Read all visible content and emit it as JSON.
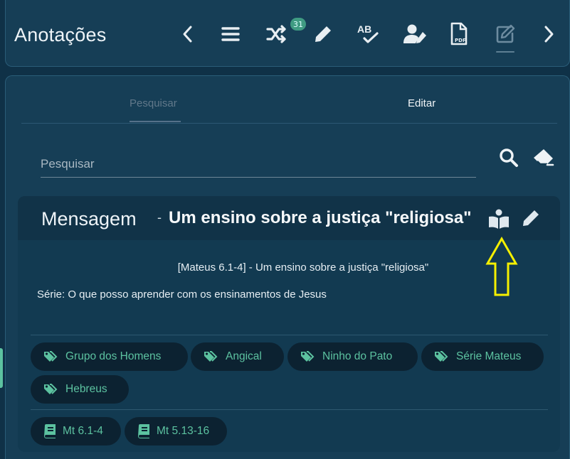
{
  "header": {
    "title": "Anotações",
    "badge_count": "31",
    "icons": [
      "chevron-left-icon",
      "list-icon",
      "shuffle-icon",
      "pencil-icon",
      "spellcheck-icon",
      "user-edit-icon",
      "pdf-file-icon",
      "edit-square-icon",
      "chevron-right-icon"
    ]
  },
  "tabs": [
    {
      "label": "Pesquisar",
      "active": true
    },
    {
      "label": "Editar",
      "active": false
    }
  ],
  "search": {
    "placeholder": "Pesquisar",
    "value": ""
  },
  "card": {
    "type_label": "Mensagem",
    "separator": "-",
    "title": "Um ensino sobre a justiça \"religiosa\"",
    "reference_line": "[Mateus 6.1-4] - Um ensino sobre a justiça \"religiosa\"",
    "series_line": "Série: O que posso aprender com os ensinamentos de Jesus",
    "tags": [
      "Grupo dos Homens",
      "Angical",
      "Ninho do Pato",
      "Série Mateus",
      "Hebreus"
    ],
    "references": [
      "Mt 6.1-4",
      "Mt 5.13-16"
    ]
  },
  "colors": {
    "background": "#0f3147",
    "panel": "#163e56",
    "accent": "#5cc2a0",
    "annotation_arrow": "#f5f000"
  }
}
